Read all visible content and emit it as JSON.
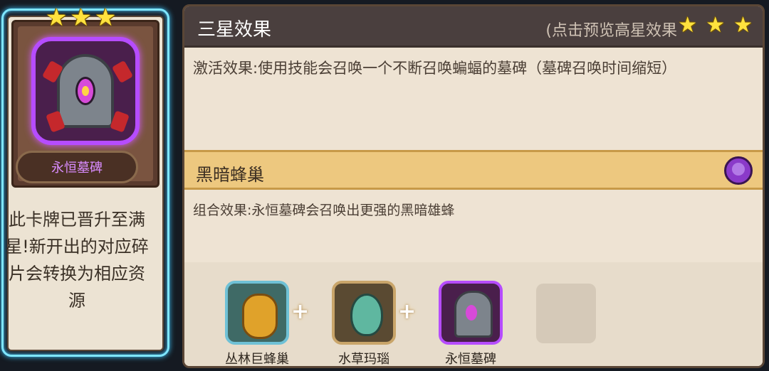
{
  "card": {
    "star_count": 3,
    "name": "永恒墓碑",
    "max_star_text": "此卡牌已晋升至满星!新开出的对应碎片会转换为相应资源",
    "frame_color": "#7fe6ff",
    "name_color": "#d98cff"
  },
  "panel": {
    "title": "三星效果",
    "preview_link": "(点击预览高星效果",
    "header_star_count": 3,
    "effect_text": "激活效果:使用技能会召唤一个不断召唤蝙蝠的墓碑（墓碑召唤时间缩短）",
    "combo_title": "黑暗蜂巢",
    "combo_icon": "purple-beetle-icon",
    "combo_text": "组合效果:永恒墓碑会召唤出更强的黑暗雄蜂",
    "plus_symbol": "+",
    "items": [
      {
        "label": "丛林巨蜂巢",
        "icon": "beehive-icon"
      },
      {
        "label": "水草玛瑙",
        "icon": "agate-amulet-icon"
      },
      {
        "label": "永恒墓碑",
        "icon": "eternal-tombstone-icon"
      }
    ]
  },
  "colors": {
    "combo_header_bg": "#edc87f",
    "panel_bg": "#eee3d3",
    "header_bg": "#4a3f3e",
    "star": "#ffe23e"
  }
}
